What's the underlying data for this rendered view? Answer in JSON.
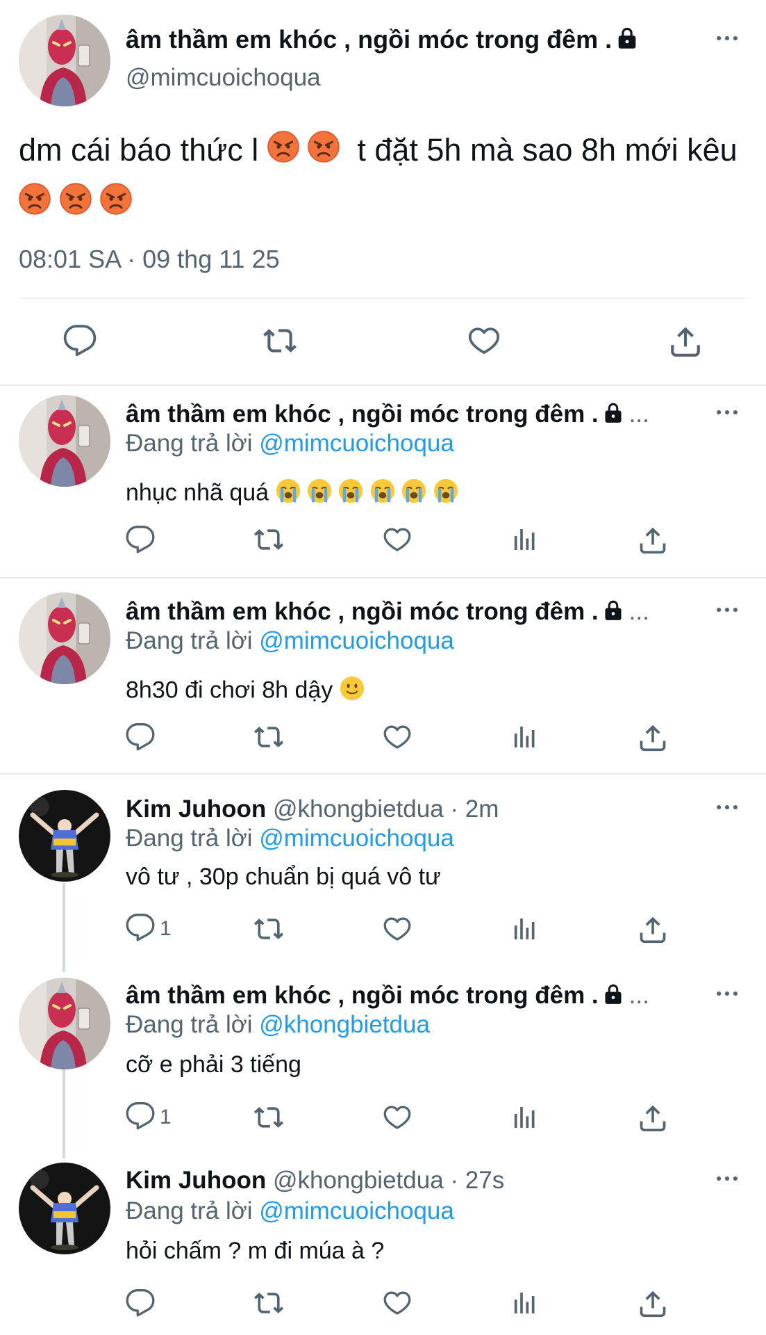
{
  "main": {
    "display_name": "âm thầm em khóc , ngồi móc trong đêm .",
    "handle": "@mimcuoichoqua",
    "text_part1": "dm cái báo thức l",
    "text_part2": "t đặt 5h mà sao 8h mới kêu",
    "timestamp": "08:01 SA · 09 thg 11 25"
  },
  "replies": [
    {
      "display_name": "âm thầm em khóc , ngồi móc trong đêm .",
      "ellipsis": "...",
      "reply_prefix": "Đang trả lời",
      "reply_to": "@mimcuoichoqua",
      "text": "nhục nhã quá"
    },
    {
      "display_name": "âm thầm em khóc , ngồi móc trong đêm .",
      "ellipsis": "...",
      "reply_prefix": "Đang trả lời",
      "reply_to": "@mimcuoichoqua",
      "text": "8h30 đi chơi 8h dậy"
    },
    {
      "display_name": "Kim Juhoon",
      "meta": "@khongbietdua · 2m",
      "reply_prefix": "Đang trả lời",
      "reply_to": "@mimcuoichoqua",
      "text": "vô tư , 30p chuẩn bị quá vô tư",
      "reply_count": "1"
    },
    {
      "display_name": "âm thầm em khóc , ngồi móc trong đêm .",
      "ellipsis": "...",
      "reply_prefix": "Đang trả lời",
      "reply_to": "@khongbietdua",
      "text": "cỡ e phải 3 tiếng",
      "reply_count": "1"
    },
    {
      "display_name": "Kim Juhoon",
      "meta": "@khongbietdua · 27s",
      "reply_prefix": "Đang trả lời",
      "reply_to": "@mimcuoichoqua",
      "text": "hỏi chấm ? m đi múa à ?"
    }
  ],
  "icons": [
    "more-icon",
    "lock-icon",
    "reply-icon",
    "retweet-icon",
    "like-icon",
    "views-icon",
    "share-icon",
    "angry-emoji",
    "crying-emoji",
    "smile-emoji"
  ],
  "colors": {
    "accent": "#1d9bf0",
    "secondary_text": "#536471",
    "divider": "#eff3f4"
  }
}
